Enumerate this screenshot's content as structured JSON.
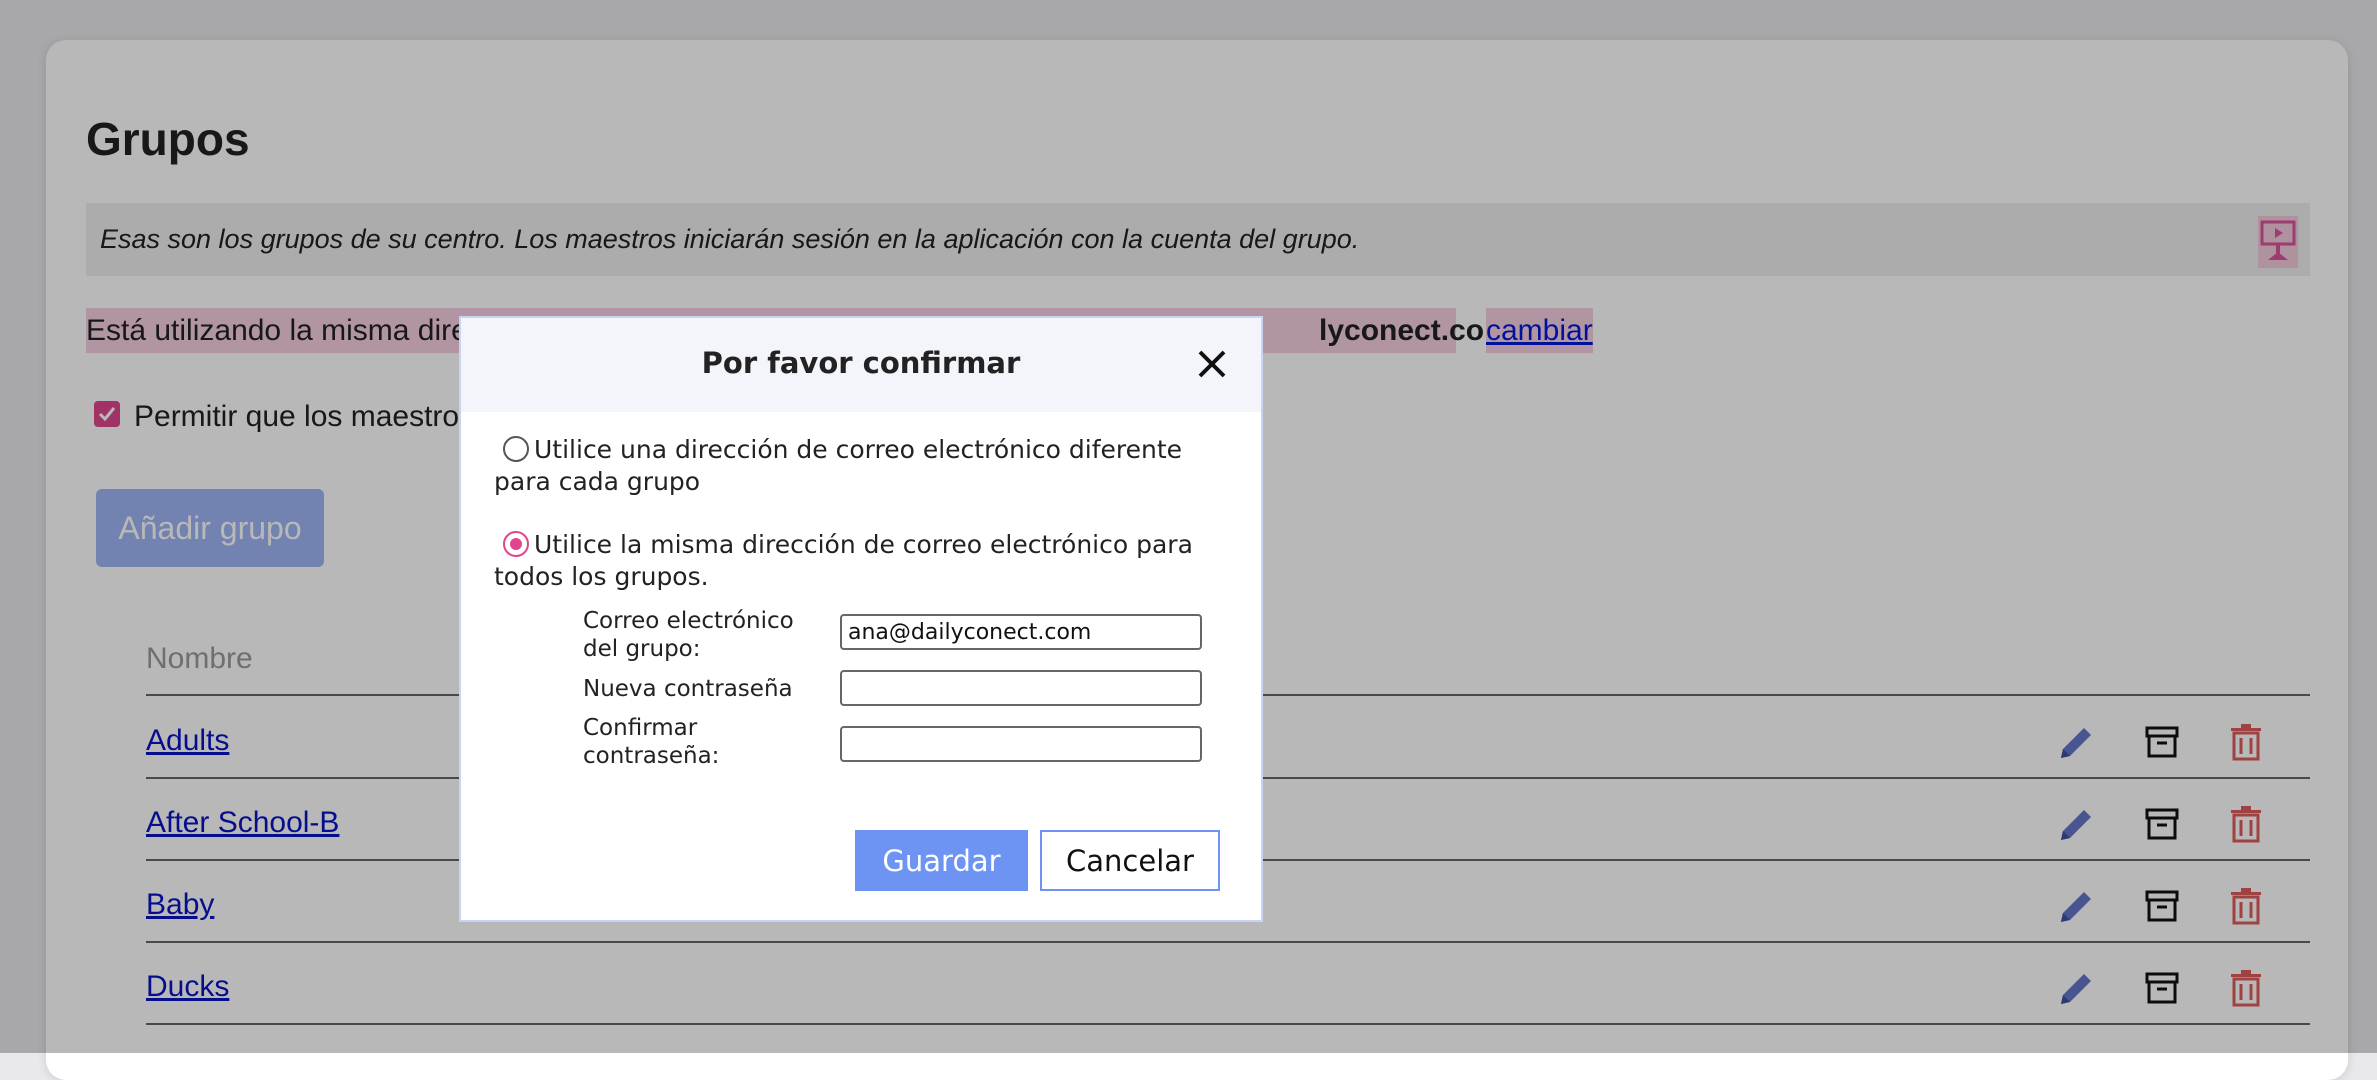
{
  "page": {
    "title": "Grupos",
    "info_text": "Esas son los grupos de su centro. Los maestros iniciarán sesión en la aplicación con la cuenta del grupo.",
    "email_notice_prefix": "Está utilizando la misma dire",
    "email_notice_suffix": "lyconect.com",
    "change_link": "cambiar",
    "allow_checkbox_label": "Permitir que los maestro",
    "add_group_button": "Añadir grupo",
    "table": {
      "column_header": "Nombre",
      "rows": [
        "Adults",
        "After School-B",
        "Baby",
        "Ducks"
      ]
    }
  },
  "modal": {
    "title": "Por favor confirmar",
    "option_different": "Utilice una dirección de correo electrónico diferente para cada grupo",
    "option_same": "Utilice la misma dirección de correo electrónico para todos los grupos.",
    "selected_option": "same",
    "email_label": "Correo electrónico del grupo:",
    "email_value": "ana@dailyconect.com",
    "new_password_label": "Nueva contraseña",
    "confirm_password_label": "Confirmar contraseña:",
    "save_button": "Guardar",
    "cancel_button": "Cancelar"
  },
  "colors": {
    "accent_pink": "#e0468d",
    "link_blue": "#0a14c4",
    "primary_blue": "#6d94f2",
    "delete_red": "#e05c5c"
  }
}
